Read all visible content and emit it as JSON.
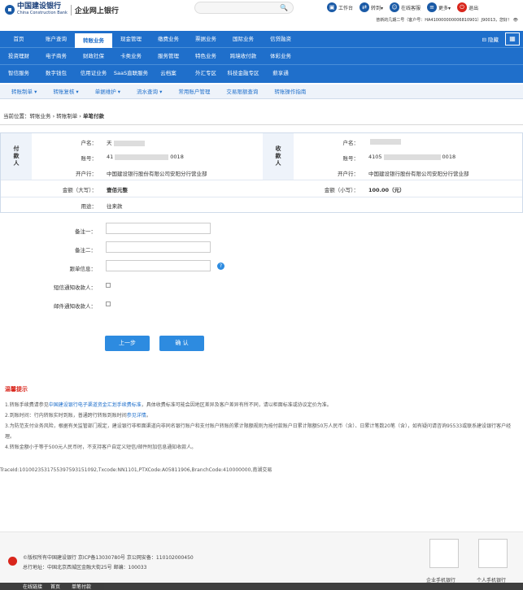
{
  "header": {
    "bank_name": "中国建设银行",
    "bank_name_en": "China Construction Bank",
    "product": "企业网上银行",
    "icons": [
      {
        "name": "workbench-icon",
        "label": "工作台"
      },
      {
        "name": "transfer-icon",
        "label": "转到▾"
      },
      {
        "name": "service-icon",
        "label": "在线客服"
      },
      {
        "name": "more-icon",
        "label": "更多▾"
      },
      {
        "name": "logout-icon",
        "label": "退出"
      }
    ],
    "user_line": "普新的几期二号（客户号：HA410000000006810901）J90013，您好！ 👁"
  },
  "nav": {
    "row1": [
      "首页",
      "账户查询",
      "转账业务",
      "现金管理",
      "缴费业务",
      "票据业务",
      "国际业务",
      "信贷融资"
    ],
    "row2": [
      "投资理财",
      "电子商务",
      "财政社保",
      "卡类业务",
      "服务管理",
      "特色业务",
      "跨境收付款",
      "体彩业务"
    ],
    "row3": [
      "智信服务",
      "数字钱包",
      "信用证业务",
      "SaaS直联服务",
      "云档案",
      "外汇专区",
      "科技金融专区",
      "薪享通"
    ],
    "active": "转账业务",
    "hide_label": "隐藏"
  },
  "subnav": [
    "转账制单 ▾",
    "转账复核 ▾",
    "单据维护 ▾",
    "流水查询 ▾",
    "常用账户管理",
    "交易限额查询",
    "转账操作指南"
  ],
  "breadcrumb": {
    "prefix": "当前位置：转账业务 › 转账制单 › ",
    "current": "单笔付款"
  },
  "payer": {
    "side": "付款人",
    "name_label": "户名：",
    "name": "天",
    "account_label": "账号：",
    "account_prefix": "41",
    "account_suffix": "0018",
    "bank_label": "开户行：",
    "bank": "中国建设银行股份有限公司安阳分行营业部"
  },
  "payee": {
    "side": "收款人",
    "name_label": "户名：",
    "name": "",
    "account_label": "账号：",
    "account_prefix": "4105",
    "account_suffix": "0018",
    "bank_label": "开户行：",
    "bank": "中国建设银行股份有限公司安阳分行营业部"
  },
  "amount": {
    "upper_label": "金额（大写）：",
    "upper": "壹佰元整",
    "lower_label": "金额（小写）：",
    "lower": "100.00（元）",
    "purpose_label": "用途：",
    "purpose": "往来款"
  },
  "form": {
    "note1_label": "备注一：",
    "note2_label": "备注二：",
    "follow_label": "跟单信息：",
    "sms_label": "短信通知收款人：",
    "mail_label": "邮件通知收款人：",
    "prev_button": "上一步",
    "confirm_button": "确 认"
  },
  "tips": {
    "title": "温馨提示",
    "lines": [
      {
        "a": "1.转账手续费请参见",
        "link": "中国建设银行电子渠道资金汇划手续费标准",
        "b": "，具体收费标准可能会因地区差异及客户差异有所不同，请以柜面标准或协议定价为准。"
      },
      {
        "a": "2.到账时间：行内转账实时到账，普通跨行转账到账时间",
        "link": "参见详情",
        "b": "。"
      },
      {
        "a": "3.为防范支付业务风险，根据有关监管部门规定，建设银行非柜面渠道向非同名银行账户和支付账户转账的累计限额规则为按付款账户日累计限额50万人民币（含）、日累计笔数20笔（含），如有疑问请咨询95533或联系建设银行客户经理。",
        "link": "",
        "b": ""
      },
      {
        "a": "4.转账金额小于等于500元人民币时，不支持客户自定义短信/邮件附加信息通知收款人。",
        "link": "",
        "b": ""
      }
    ]
  },
  "trace": "TraceId:1010023531755397593151092,Txcode:NN1101,PTXCode:A05811906,BranchCode:410000000,南湖交易",
  "footer": {
    "copyright": "©版权所有中国建设银行    京ICP备13030780号    京公网安备：110102000450",
    "address": "总行地址：中国北京西城区金融大街25号    邮编：100033",
    "qr1": "企业手机银行",
    "qr2": "个人手机银行"
  },
  "taskbar": {
    "left": "在线链接",
    "tab1": "首页",
    "tab2": "单笔付款"
  }
}
